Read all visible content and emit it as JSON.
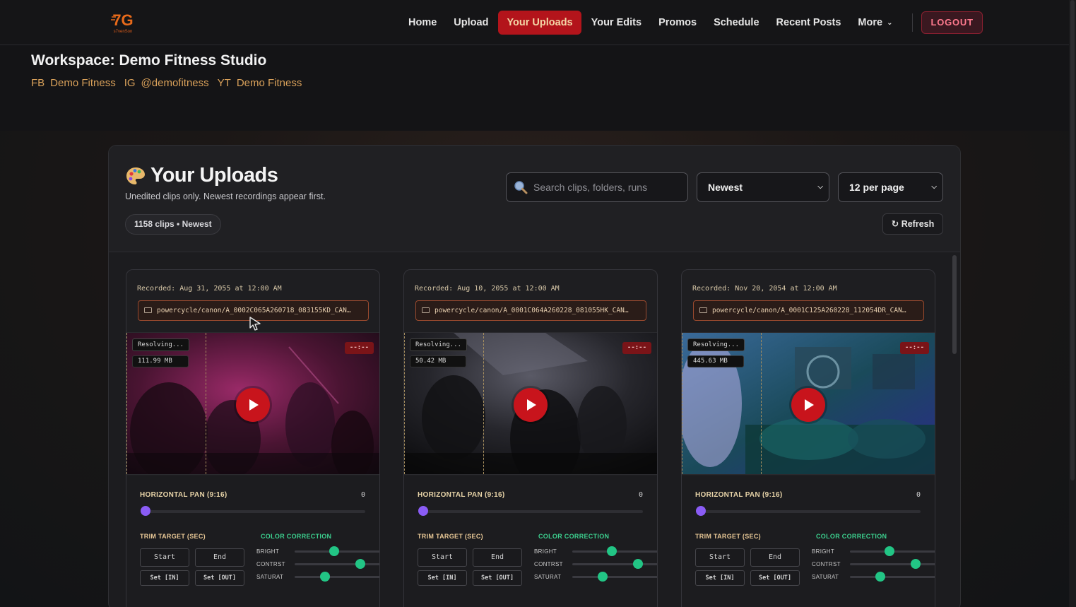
{
  "nav": {
    "logo_text": "s7venSon",
    "links": [
      "Home",
      "Upload",
      "Your Uploads",
      "Your Edits",
      "Promos",
      "Schedule",
      "Recent Posts",
      "More"
    ],
    "active_index": 2,
    "logout_label": "LOGOUT"
  },
  "workspace": {
    "title": "Workspace: Demo Fitness Studio",
    "fb_tag": "FB",
    "fb_name": "Demo Fitness",
    "ig_tag": "IG",
    "ig_name": "@demofitness",
    "yt_tag": "YT",
    "yt_name": "Demo Fitness"
  },
  "panel": {
    "title": "Your Uploads",
    "subtitle": "Unedited clips only. Newest recordings appear first.",
    "count_pill": "1158 clips • Newest",
    "search_placeholder": "Search clips, folders, runs",
    "sort_value": "Newest",
    "per_page_value": "12 per page",
    "refresh_label": "Refresh"
  },
  "cards": [
    {
      "recorded": "Recorded: Aug 31, 2055 at 12:00 AM",
      "path": "powercycle/canon/A_0002C065A260718_083155KD_CAN…",
      "status": "Resolving...",
      "size": "111.99 MB",
      "duration": "--:--",
      "pan_label": "HORIZONTAL PAN (9:16)",
      "pan_value": "0",
      "trim_label": "TRIM TARGET (SEC)",
      "cc_label": "COLOR CORRECTION",
      "start_label": "Start",
      "end_label": "End",
      "set_in_label": "Set [IN]",
      "set_out_label": "Set [OUT]",
      "bright_label": "BRIGHT",
      "contrast_label": "CONTRST",
      "saturation_label": "SATURAT",
      "scene_colors": [
        "#3a0f28",
        "#8a1f5a",
        "#1a0a14"
      ]
    },
    {
      "recorded": "Recorded: Aug 10, 2055 at 12:00 AM",
      "path": "powercycle/canon/A_0001C064A260228_081055HK_CAN…",
      "status": "Resolving...",
      "size": "50.42 MB",
      "duration": "--:--",
      "pan_label": "HORIZONTAL PAN (9:16)",
      "pan_value": "0",
      "trim_label": "TRIM TARGET (SEC)",
      "cc_label": "COLOR CORRECTION",
      "start_label": "Start",
      "end_label": "End",
      "set_in_label": "Set [IN]",
      "set_out_label": "Set [OUT]",
      "bright_label": "BRIGHT",
      "contrast_label": "CONTRST",
      "saturation_label": "SATURAT",
      "scene_colors": [
        "#1a1a1e",
        "#4a4a55",
        "#0c0c0e"
      ]
    },
    {
      "recorded": "Recorded: Nov 20, 2054 at 12:00 AM",
      "path": "powercycle/canon/A_0001C125A260228_112054DR_CAN…",
      "status": "Resolving...",
      "size": "445.63 MB",
      "duration": "--:--",
      "pan_label": "HORIZONTAL PAN (9:16)",
      "pan_value": "0",
      "trim_label": "TRIM TARGET (SEC)",
      "cc_label": "COLOR CORRECTION",
      "start_label": "Start",
      "end_label": "End",
      "set_in_label": "Set [IN]",
      "set_out_label": "Set [OUT]",
      "bright_label": "BRIGHT",
      "contrast_label": "CONTRST",
      "saturation_label": "SATURAT",
      "scene_colors": [
        "#0f2a3a",
        "#1f6a6a",
        "#1a3a8a"
      ]
    }
  ]
}
